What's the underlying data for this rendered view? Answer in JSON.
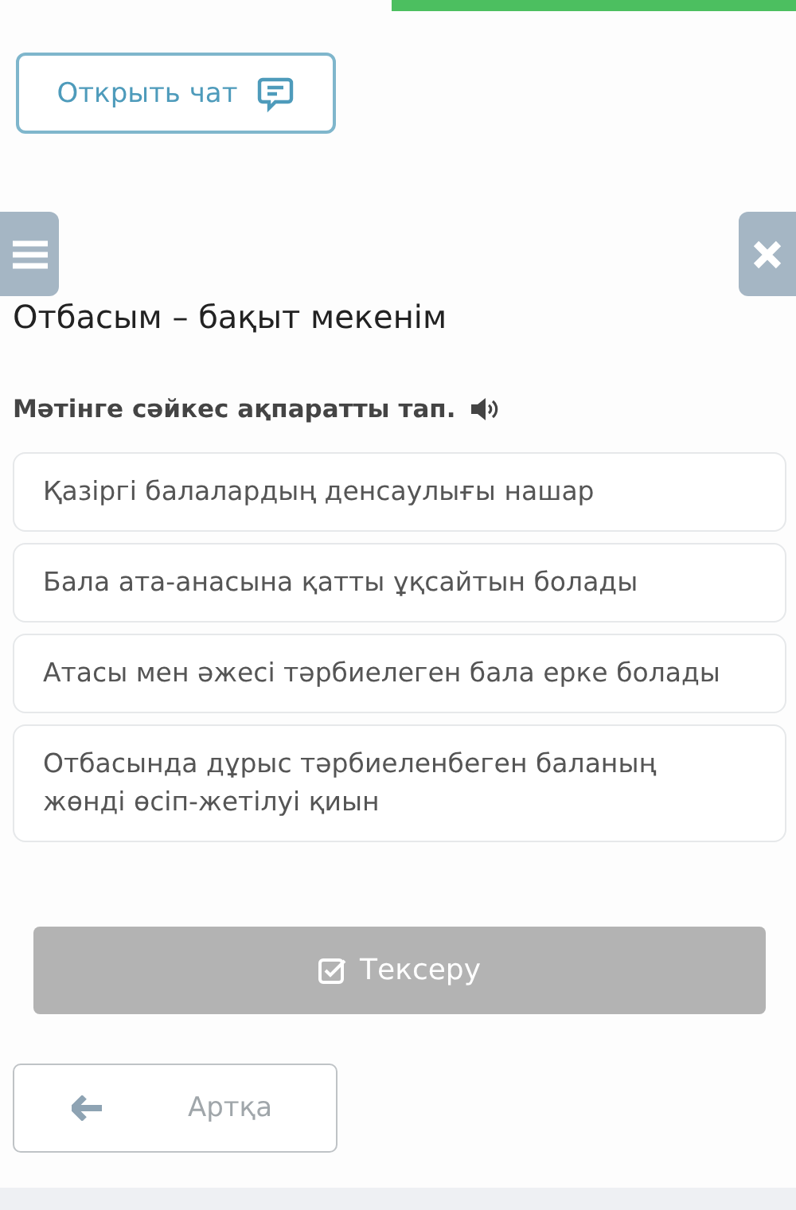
{
  "chat_button": {
    "label": "Открыть чат"
  },
  "title": "Отбасым – бақыт мекенім",
  "question": "Мәтінге сәйкес ақпаратты тап.",
  "options": [
    {
      "text": "Қазіргі балалардың денсаулығы нашар"
    },
    {
      "text": "Бала ата-анасына қатты ұқсайтын болады"
    },
    {
      "text": "Атасы мен әжесі тәрбиелеген бала ерке болады"
    },
    {
      "text": "Отбасында дұрыс тәрбиеленбеген баланың жөнді өсіп-жетілуі қиын"
    }
  ],
  "check_button": {
    "label": "Тексеру",
    "disabled": true
  },
  "back_button": {
    "label": "Артқа"
  }
}
